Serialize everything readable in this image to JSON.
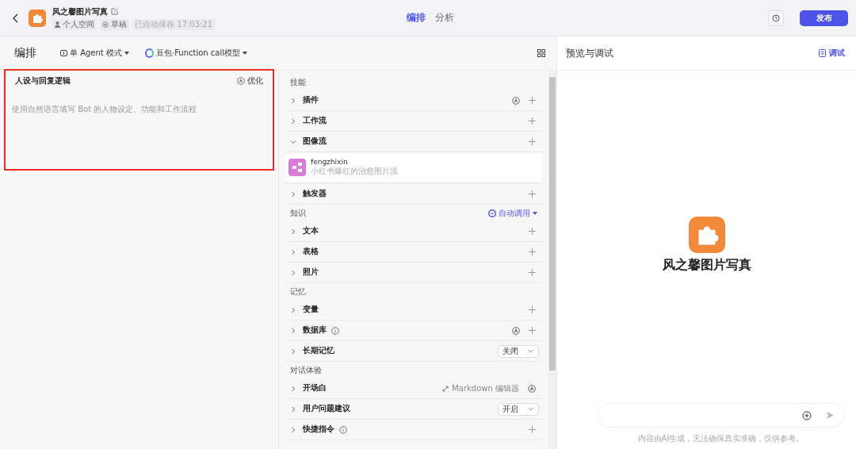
{
  "header": {
    "bot_name": "风之馨图片写真",
    "space": "个人空间",
    "status": "草稿",
    "autosave": "已自动保存 17:03:21",
    "tabs": [
      {
        "label": "编排",
        "selected": true
      },
      {
        "label": "分析",
        "selected": false
      }
    ],
    "publish": "发布"
  },
  "toolbar": {
    "title": "编排",
    "mode": "单 Agent 模式",
    "model": "豆包·Function call模型"
  },
  "persona": {
    "title": "人设与回复逻辑",
    "optimize": "优化",
    "placeholder": "使用自然语言填写 Bot 的人物设定、功能和工作流程",
    "highlighted": true
  },
  "sections": [
    {
      "title": "技能",
      "items": [
        {
          "label": "插件",
          "expanded": false,
          "info": false,
          "trailing": [
            {
              "kind": "auto"
            },
            {
              "kind": "add"
            }
          ]
        },
        {
          "label": "工作流",
          "expanded": false,
          "info": false,
          "trailing": [
            {
              "kind": "add"
            }
          ]
        },
        {
          "label": "图像流",
          "expanded": true,
          "info": false,
          "trailing": [
            {
              "kind": "add"
            }
          ],
          "children": [
            {
              "name": "fengzhixin",
              "desc": "小红书爆红的治愈图片流"
            }
          ]
        },
        {
          "label": "触发器",
          "expanded": false,
          "info": false,
          "trailing": [
            {
              "kind": "add"
            }
          ]
        }
      ]
    },
    {
      "title": "知识",
      "action": "自动调用",
      "items": [
        {
          "label": "文本",
          "expanded": false,
          "info": false,
          "trailing": [
            {
              "kind": "add"
            }
          ]
        },
        {
          "label": "表格",
          "expanded": false,
          "info": false,
          "trailing": [
            {
              "kind": "add"
            }
          ]
        },
        {
          "label": "照片",
          "expanded": false,
          "info": false,
          "trailing": [
            {
              "kind": "add"
            }
          ]
        }
      ]
    },
    {
      "title": "记忆",
      "items": [
        {
          "label": "变量",
          "expanded": false,
          "info": false,
          "trailing": [
            {
              "kind": "add"
            }
          ]
        },
        {
          "label": "数据库",
          "expanded": false,
          "info": true,
          "trailing": [
            {
              "kind": "auto"
            },
            {
              "kind": "add"
            }
          ]
        },
        {
          "label": "长期记忆",
          "expanded": false,
          "info": false,
          "trailing": [
            {
              "kind": "select",
              "label": "关闭"
            }
          ]
        }
      ]
    },
    {
      "title": "对话体验",
      "items": [
        {
          "label": "开场白",
          "expanded": false,
          "info": false,
          "trailing": [
            {
              "kind": "markdown",
              "label": "Markdown 编辑器"
            },
            {
              "kind": "auto"
            }
          ]
        },
        {
          "label": "用户问题建议",
          "expanded": false,
          "info": false,
          "trailing": [
            {
              "kind": "select",
              "label": "开启"
            }
          ]
        },
        {
          "label": "快捷指令",
          "expanded": false,
          "info": true,
          "trailing": [
            {
              "kind": "add"
            }
          ]
        }
      ]
    }
  ],
  "preview": {
    "title": "预览与调试",
    "debug": "调试",
    "bot_name": "风之馨图片写真",
    "disclaimer": "内容由AI生成，无法确保真实准确，仅供参考。"
  }
}
